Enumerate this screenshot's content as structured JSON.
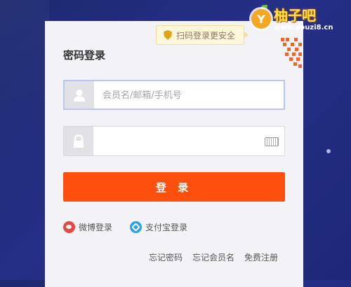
{
  "login": {
    "title": "密码登录",
    "qr_tip": "扫码登录更安全",
    "username": {
      "placeholder": "会员名/邮箱/手机号",
      "value": ""
    },
    "password": {
      "placeholder": "",
      "value": ""
    },
    "submit_label": "登 录",
    "third_party": [
      {
        "label": "微博登录",
        "icon": "weibo-icon"
      },
      {
        "label": "支付宝登录",
        "icon": "alipay-icon"
      }
    ],
    "links": [
      "忘记密码",
      "忘记会员名",
      "免费注册"
    ]
  },
  "watermark": {
    "name": "柚子吧",
    "url": "www.youzi8.cn",
    "badge": "Y"
  },
  "colors": {
    "background": "#242f86",
    "button": "#fd4f0e",
    "accent_border": "#b7c6f2"
  }
}
